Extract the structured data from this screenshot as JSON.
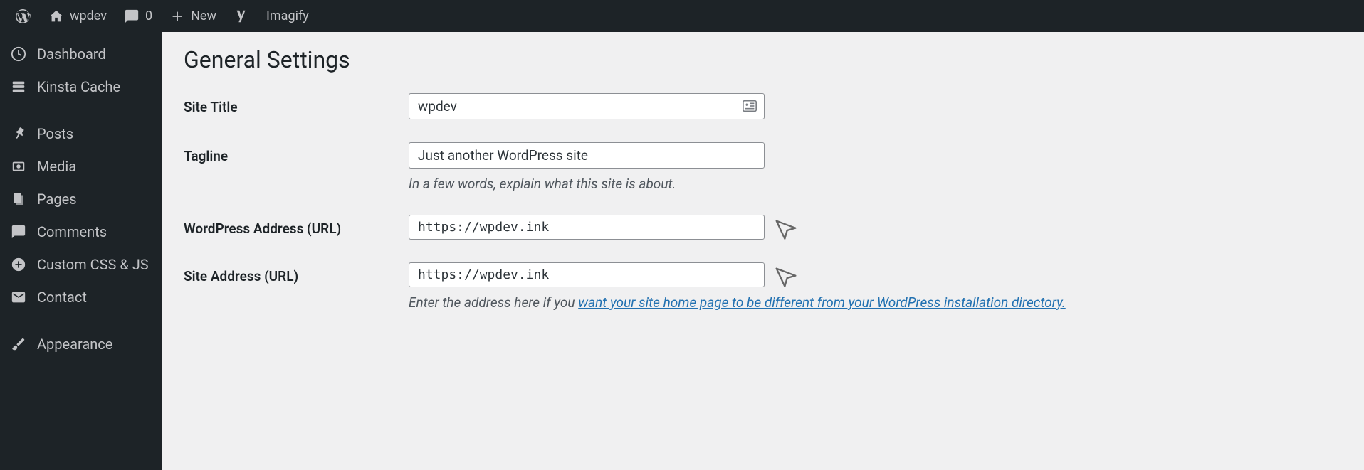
{
  "adminbar": {
    "site_name": "wpdev",
    "comments_count": "0",
    "new_label": "New",
    "imagify_label": "Imagify"
  },
  "sidebar": {
    "items": [
      {
        "label": "Dashboard",
        "icon": "dashboard"
      },
      {
        "label": "Kinsta Cache",
        "icon": "cache"
      },
      {
        "label": "Posts",
        "icon": "pin"
      },
      {
        "label": "Media",
        "icon": "media"
      },
      {
        "label": "Pages",
        "icon": "page"
      },
      {
        "label": "Comments",
        "icon": "comment"
      },
      {
        "label": "Custom CSS & JS",
        "icon": "plus"
      },
      {
        "label": "Contact",
        "icon": "mail"
      },
      {
        "label": "Appearance",
        "icon": "brush"
      }
    ]
  },
  "page": {
    "title": "General Settings",
    "fields": {
      "site_title_label": "Site Title",
      "site_title_value": "wpdev",
      "tagline_label": "Tagline",
      "tagline_value": "Just another WordPress site",
      "tagline_description": "In a few words, explain what this site is about.",
      "wp_url_label": "WordPress Address (URL)",
      "wp_url_value": "https://wpdev.ink",
      "site_url_label": "Site Address (URL)",
      "site_url_value": "https://wpdev.ink",
      "site_url_description_prefix": "Enter the address here if you ",
      "site_url_description_link": "want your site home page to be different from your WordPress installation directory."
    }
  }
}
